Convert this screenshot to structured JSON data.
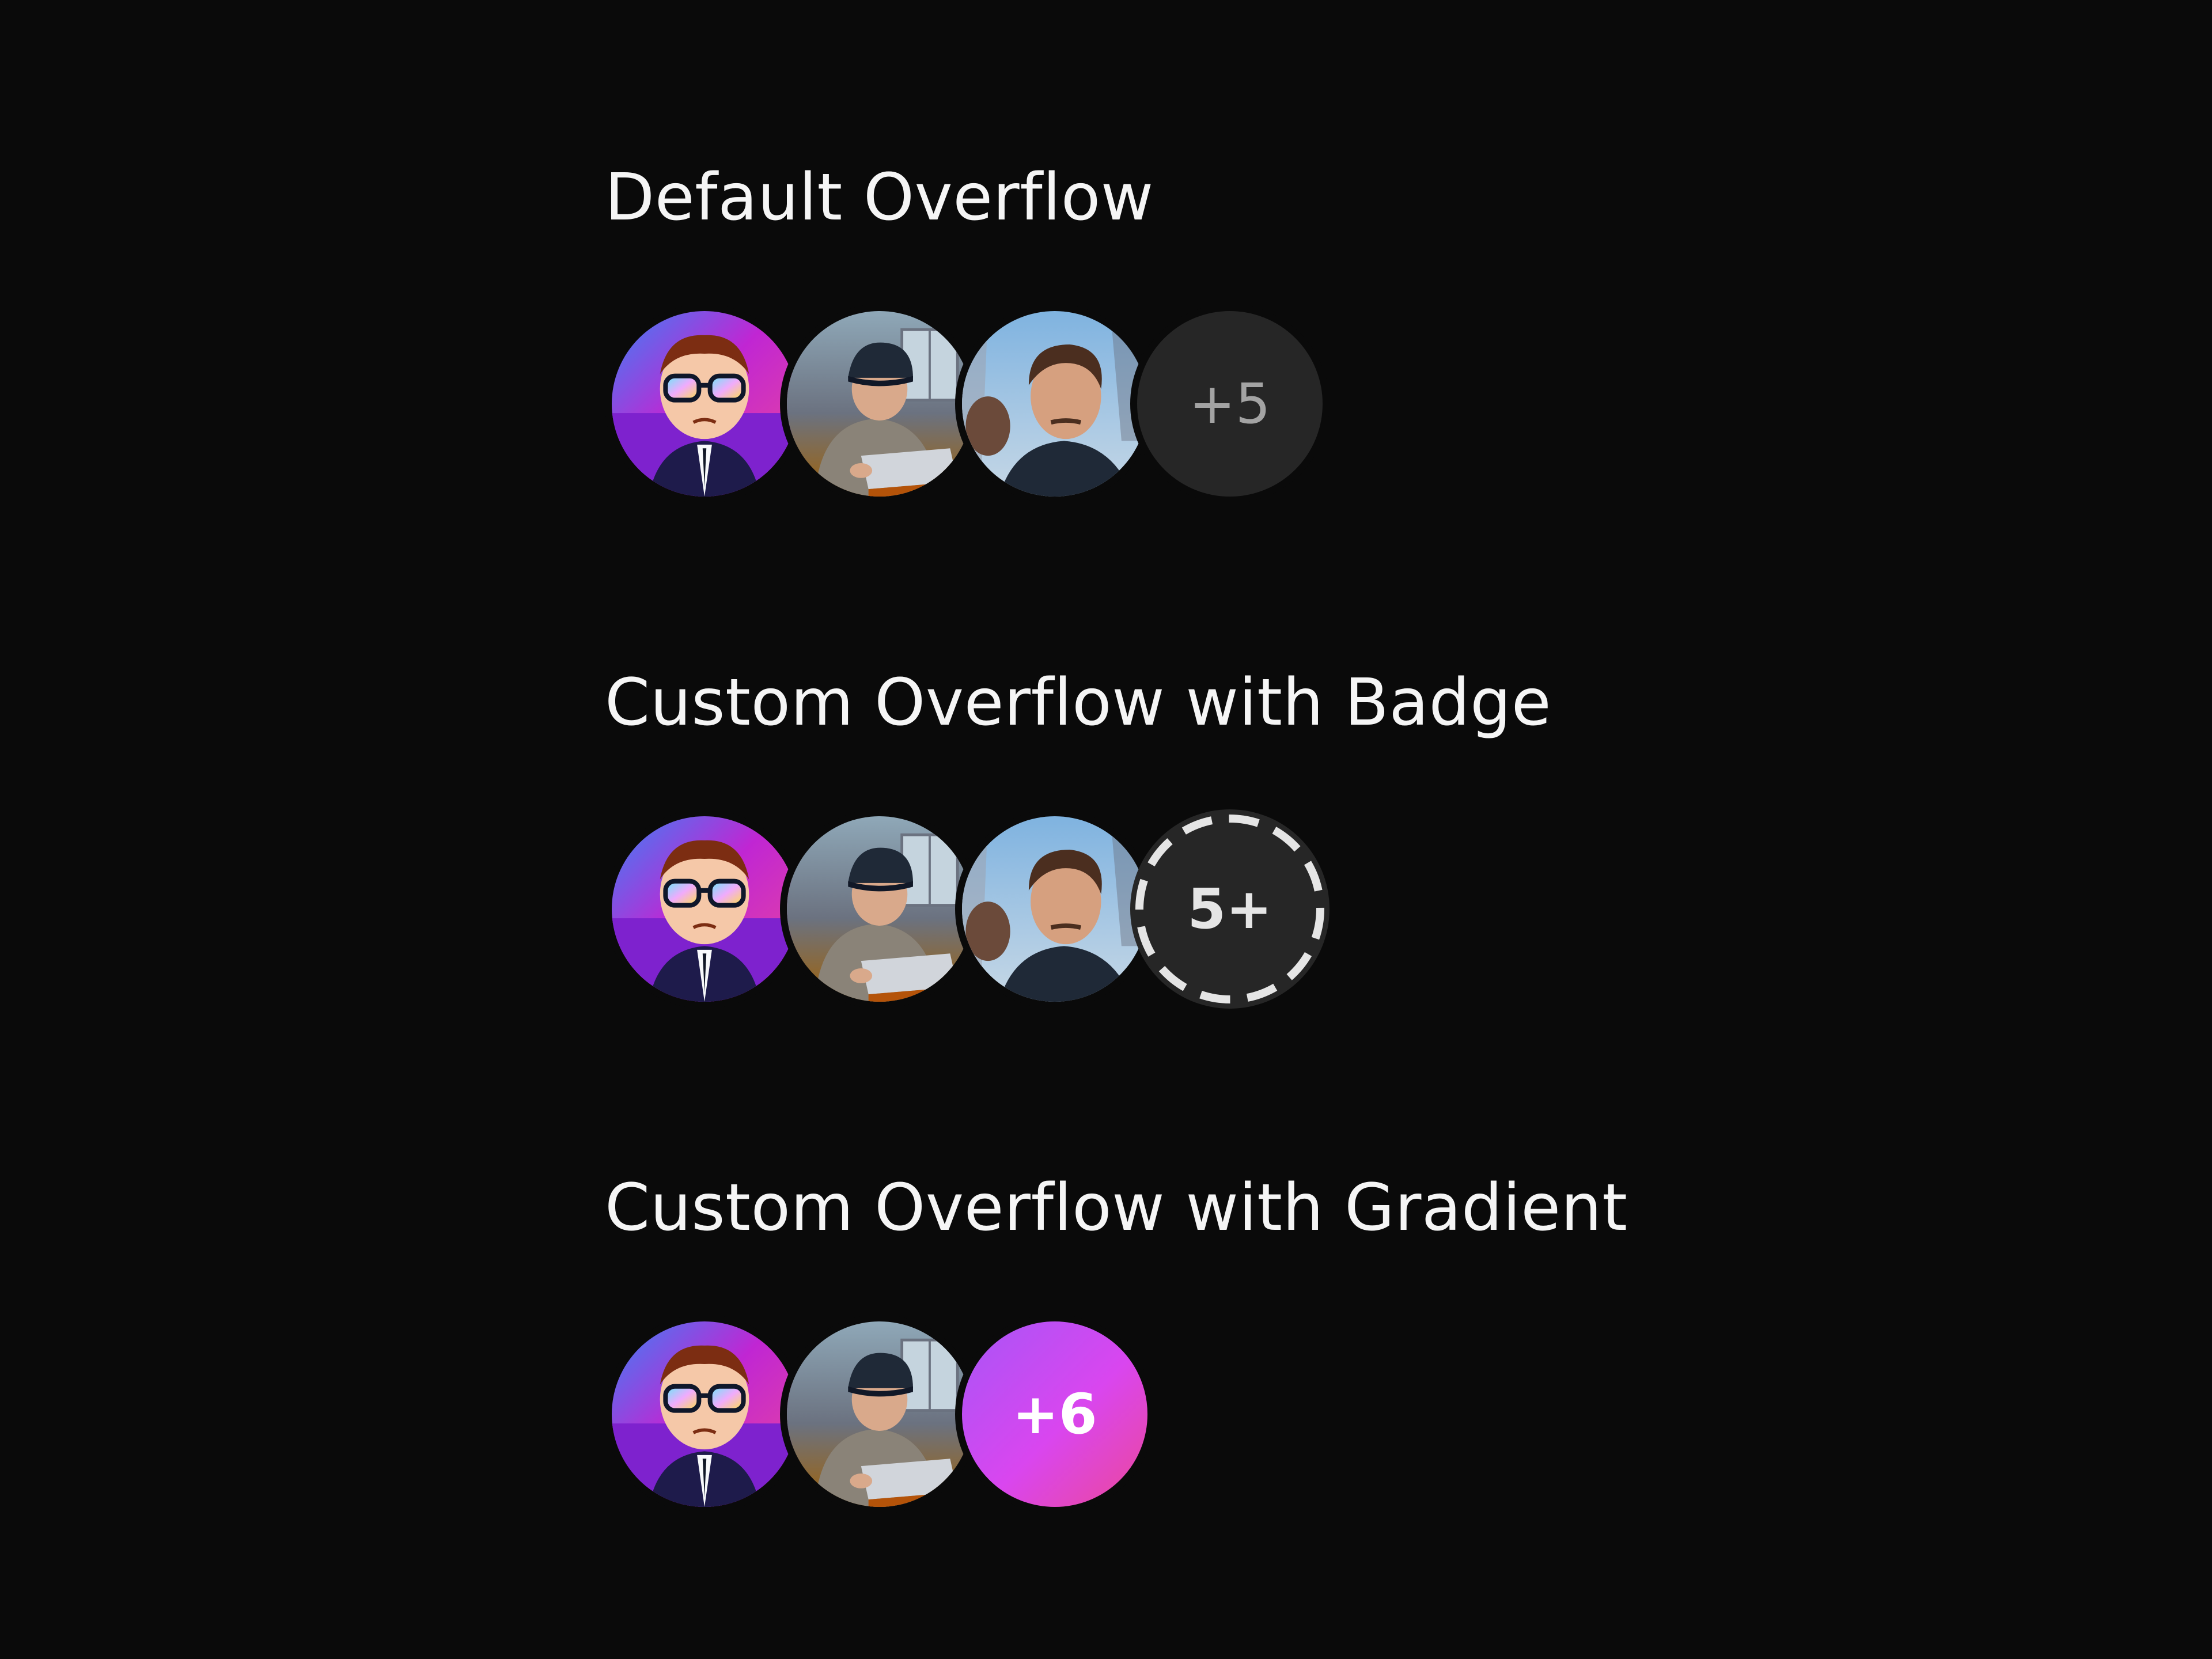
{
  "sections": [
    {
      "title": "Default Overflow",
      "avatars": [
        {
          "name": "cartoon-sunglasses"
        },
        {
          "name": "person-cap-laptop"
        },
        {
          "name": "man-smiling-outdoors"
        }
      ],
      "overflow_label": "+5",
      "overflow_style": "default"
    },
    {
      "title": "Custom Overflow with Badge",
      "avatars": [
        {
          "name": "cartoon-sunglasses"
        },
        {
          "name": "person-cap-laptop"
        },
        {
          "name": "man-smiling-outdoors"
        }
      ],
      "overflow_label": "5+",
      "overflow_style": "dashed-badge"
    },
    {
      "title": "Custom Overflow with Gradient",
      "avatars": [
        {
          "name": "cartoon-sunglasses"
        },
        {
          "name": "person-cap-laptop"
        }
      ],
      "overflow_label": "+6",
      "overflow_style": "gradient"
    }
  ],
  "colors": {
    "background": "#0a0a0a",
    "text": "#f5f5f5",
    "overflow_default_bg": "#262626",
    "overflow_default_text": "#a3a3a3",
    "badge_dash": "#e5e5e5",
    "gradient_start": "#a855f7",
    "gradient_end": "#ec4899"
  }
}
